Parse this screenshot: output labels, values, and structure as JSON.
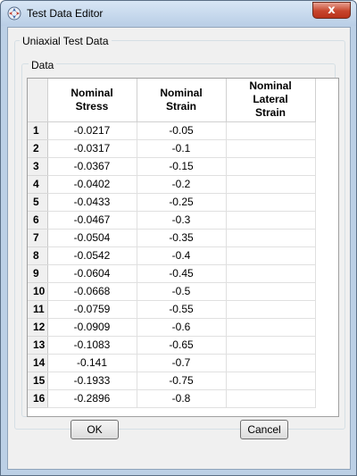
{
  "window": {
    "title": "Test Data Editor",
    "close_label": "x"
  },
  "icons": {
    "app": "abaqus-app-icon",
    "close": "close-icon"
  },
  "colors": {
    "titlebar": "#c8dbef",
    "close_button": "#c7452c",
    "client": "#f0f0f0"
  },
  "groups": {
    "outer_label": "Uniaxial Test Data",
    "inner_label": "Data"
  },
  "table": {
    "columns": [
      {
        "label": "Nominal\nStress"
      },
      {
        "label": "Nominal\nStrain"
      },
      {
        "label": "Nominal\nLateral\nStrain"
      }
    ],
    "rows": [
      {
        "index": "1",
        "stress": "-0.0217",
        "strain": "-0.05",
        "lateral": ""
      },
      {
        "index": "2",
        "stress": "-0.0317",
        "strain": "-0.1",
        "lateral": ""
      },
      {
        "index": "3",
        "stress": "-0.0367",
        "strain": "-0.15",
        "lateral": ""
      },
      {
        "index": "4",
        "stress": "-0.0402",
        "strain": "-0.2",
        "lateral": ""
      },
      {
        "index": "5",
        "stress": "-0.0433",
        "strain": "-0.25",
        "lateral": ""
      },
      {
        "index": "6",
        "stress": "-0.0467",
        "strain": "-0.3",
        "lateral": ""
      },
      {
        "index": "7",
        "stress": "-0.0504",
        "strain": "-0.35",
        "lateral": ""
      },
      {
        "index": "8",
        "stress": "-0.0542",
        "strain": "-0.4",
        "lateral": ""
      },
      {
        "index": "9",
        "stress": "-0.0604",
        "strain": "-0.45",
        "lateral": ""
      },
      {
        "index": "10",
        "stress": "-0.0668",
        "strain": "-0.5",
        "lateral": ""
      },
      {
        "index": "11",
        "stress": "-0.0759",
        "strain": "-0.55",
        "lateral": ""
      },
      {
        "index": "12",
        "stress": "-0.0909",
        "strain": "-0.6",
        "lateral": ""
      },
      {
        "index": "13",
        "stress": "-0.1083",
        "strain": "-0.65",
        "lateral": ""
      },
      {
        "index": "14",
        "stress": "-0.141",
        "strain": "-0.7",
        "lateral": ""
      },
      {
        "index": "15",
        "stress": "-0.1933",
        "strain": "-0.75",
        "lateral": ""
      },
      {
        "index": "16",
        "stress": "-0.2896",
        "strain": "-0.8",
        "lateral": ""
      }
    ]
  },
  "buttons": {
    "ok": "OK",
    "cancel": "Cancel"
  }
}
